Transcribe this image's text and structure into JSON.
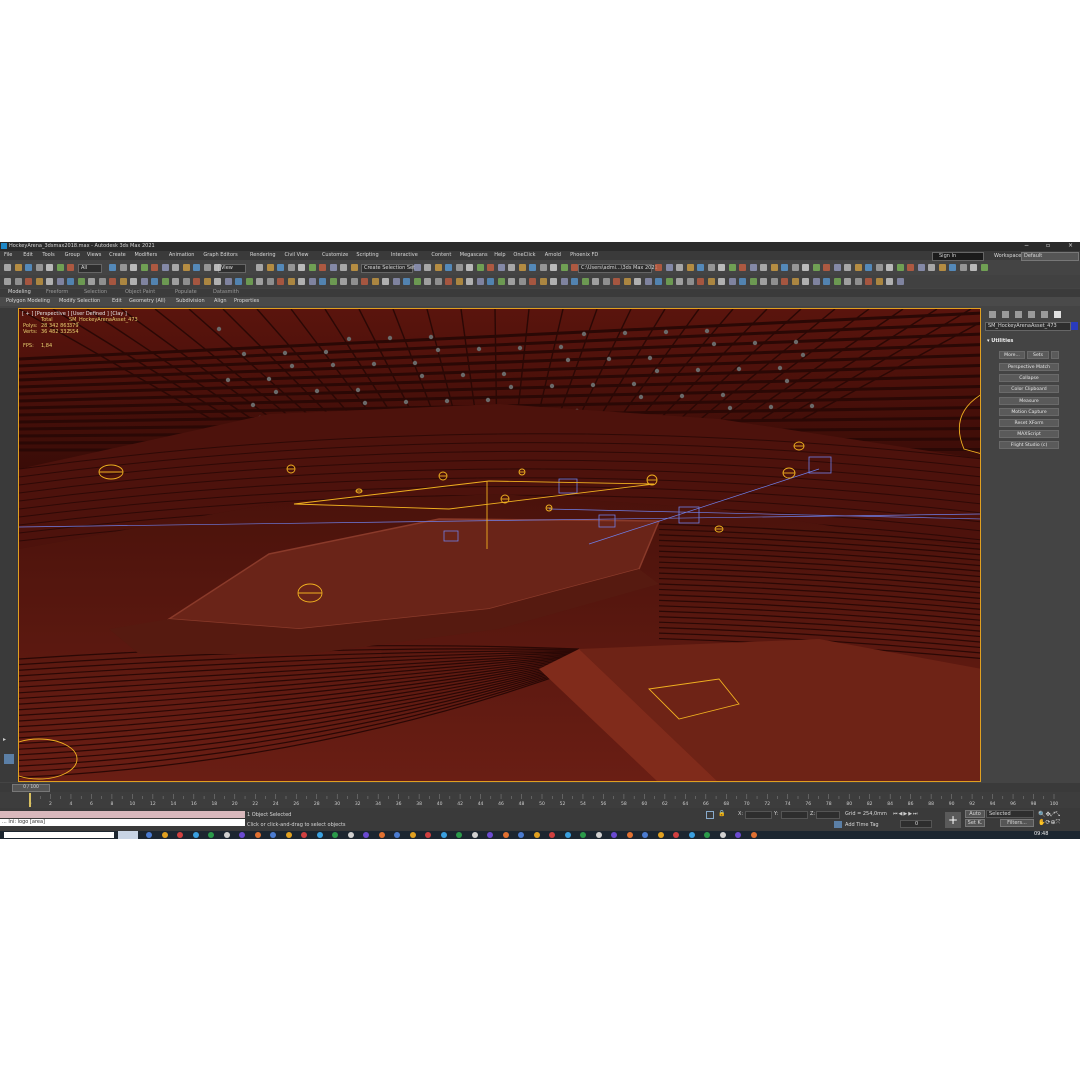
{
  "window": {
    "title": "HockeyArena_3dsmax2018.max - Autodesk 3ds Max 2021",
    "controls": [
      "−",
      "▫",
      "×"
    ]
  },
  "menu": [
    "File",
    "Edit",
    "Tools",
    "Group",
    "Views",
    "Create",
    "Modifiers",
    "Animation",
    "Graph Editors",
    "Rendering",
    "Civil View",
    "Customize",
    "Scripting",
    "Interactive",
    "Content",
    "Megascans",
    "Help",
    "OneClick",
    "Arnold",
    "Phoenix FD"
  ],
  "signin": "Sign In",
  "workspaces": {
    "label": "Workspaces:",
    "value": "Default"
  },
  "toolbar": {
    "filter": "All",
    "view": "View",
    "selection_set": "Create Selection Set",
    "path": "C:\\Users\\admi...\\3ds Max 2021"
  },
  "ribbon_tabs": [
    "Modeling",
    "Freeform",
    "Selection",
    "Object Paint",
    "Populate",
    "Datasmith"
  ],
  "ribbon_sub": [
    "Polygon Modeling",
    "Modify Selection",
    "Edit",
    "Geometry (All)",
    "Subdivision",
    "Align",
    "Properties"
  ],
  "viewport": {
    "label": "[ + ] [Perspective ] [User Defined ] [Clay ]",
    "stats_total": "Total",
    "stats_object": "SM_HockeyArenaAsset_473",
    "polys_label": "Polys:",
    "polys_total": "28 342 863",
    "polys_obj": "379",
    "verts_label": "Verts:",
    "verts_total": "36 482 332",
    "verts_obj": "554",
    "fps_label": "FPS:",
    "fps_value": "1,84"
  },
  "command_panel": {
    "object_name": "SM_HockeyArenaAsset_473",
    "rollout_title": "Utilities",
    "more_btn": "More...",
    "sets_btn": "Sets",
    "buttons": [
      "Perspective Match",
      "Collapse",
      "Color Clipboard",
      "Measure",
      "Motion Capture",
      "Reset XForm",
      "MAXScript",
      "Flight Studio (c)"
    ]
  },
  "timeline": {
    "frame_display": "0 / 100",
    "ticks": [
      "0",
      "2",
      "4",
      "6",
      "8",
      "10",
      "12",
      "14",
      "16",
      "18",
      "20",
      "22",
      "24",
      "26",
      "28",
      "30",
      "32",
      "34",
      "36",
      "38",
      "40",
      "42",
      "44",
      "46",
      "48",
      "50",
      "52",
      "54",
      "56",
      "58",
      "60",
      "62",
      "64",
      "66",
      "68",
      "70",
      "72",
      "74",
      "76",
      "78",
      "80",
      "82",
      "84",
      "86",
      "88",
      "90",
      "92",
      "94",
      "96",
      "98",
      "100"
    ]
  },
  "status": {
    "maxscript_line": "...  Ini: logo [area]",
    "selection": "1 Object Selected",
    "prompt": "Click or click-and-drag to select objects",
    "x_label": "X:",
    "y_label": "Y:",
    "z_label": "Z:",
    "grid": "Grid = 254,0mm",
    "add_time_tag": "Add Time Tag",
    "frame_value": "0",
    "auto": "Auto",
    "selected": "Selected",
    "set_k": "Set K.",
    "filters": "Filters..."
  },
  "taskbar": {
    "time": "09:48"
  },
  "colors": {
    "viewport_bg": "#3c0d08",
    "helper": "#f0b020",
    "camera": "#6f7fe8",
    "accent": "#1e88c7"
  }
}
